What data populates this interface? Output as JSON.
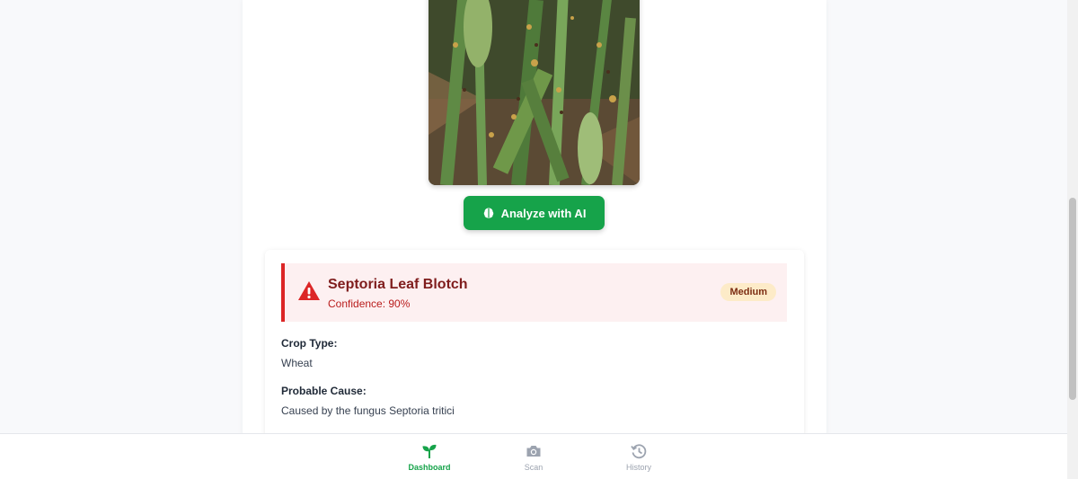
{
  "app": {
    "analyze_button_label": "Analyze with AI",
    "accent_color": "#16a34a"
  },
  "result": {
    "disease_name": "Septoria Leaf Blotch",
    "confidence_text": "Confidence: 90%",
    "severity": "Medium",
    "fields": [
      {
        "label": "Crop Type:",
        "value": "Wheat"
      },
      {
        "label": "Probable Cause:",
        "value": "Caused by the fungus Septoria tritici"
      }
    ]
  },
  "nav": {
    "items": [
      {
        "label": "Dashboard",
        "icon": "sprout-icon",
        "active": true
      },
      {
        "label": "Scan",
        "icon": "camera-icon",
        "active": false
      },
      {
        "label": "History",
        "icon": "history-icon",
        "active": false
      }
    ]
  }
}
